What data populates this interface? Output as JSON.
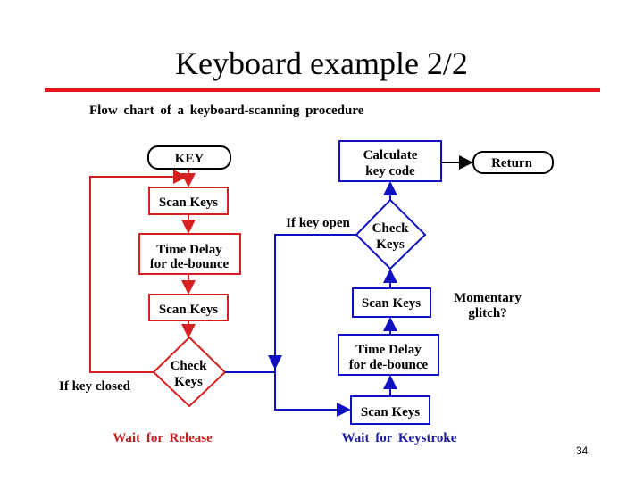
{
  "title": "Keyboard example 2/2",
  "subtitle": "Flow chart of a keyboard-scanning procedure",
  "page_number": "34",
  "colors": {
    "accent_rule": "#e8141c",
    "release_path": "#d42020",
    "keystroke_path": "#1010c0"
  },
  "release": {
    "key": "KEY",
    "scan1": "Scan Keys",
    "delay_l1": "Time Delay",
    "delay_l2": "for de-bounce",
    "scan2": "Scan Keys",
    "check_l1": "Check",
    "check_l2": "Keys",
    "closed_label": "If key closed",
    "caption": "Wait for Release"
  },
  "keystroke": {
    "calc_l1": "Calculate",
    "calc_l2": "key code",
    "return": "Return",
    "open_label": "If key open",
    "check_l1": "Check",
    "check_l2": "Keys",
    "scan_top": "Scan Keys",
    "glitch_l1": "Momentary",
    "glitch_l2": "glitch?",
    "delay_l1": "Time Delay",
    "delay_l2": "for de-bounce",
    "scan_bottom": "Scan Keys",
    "caption": "Wait for Keystroke"
  }
}
